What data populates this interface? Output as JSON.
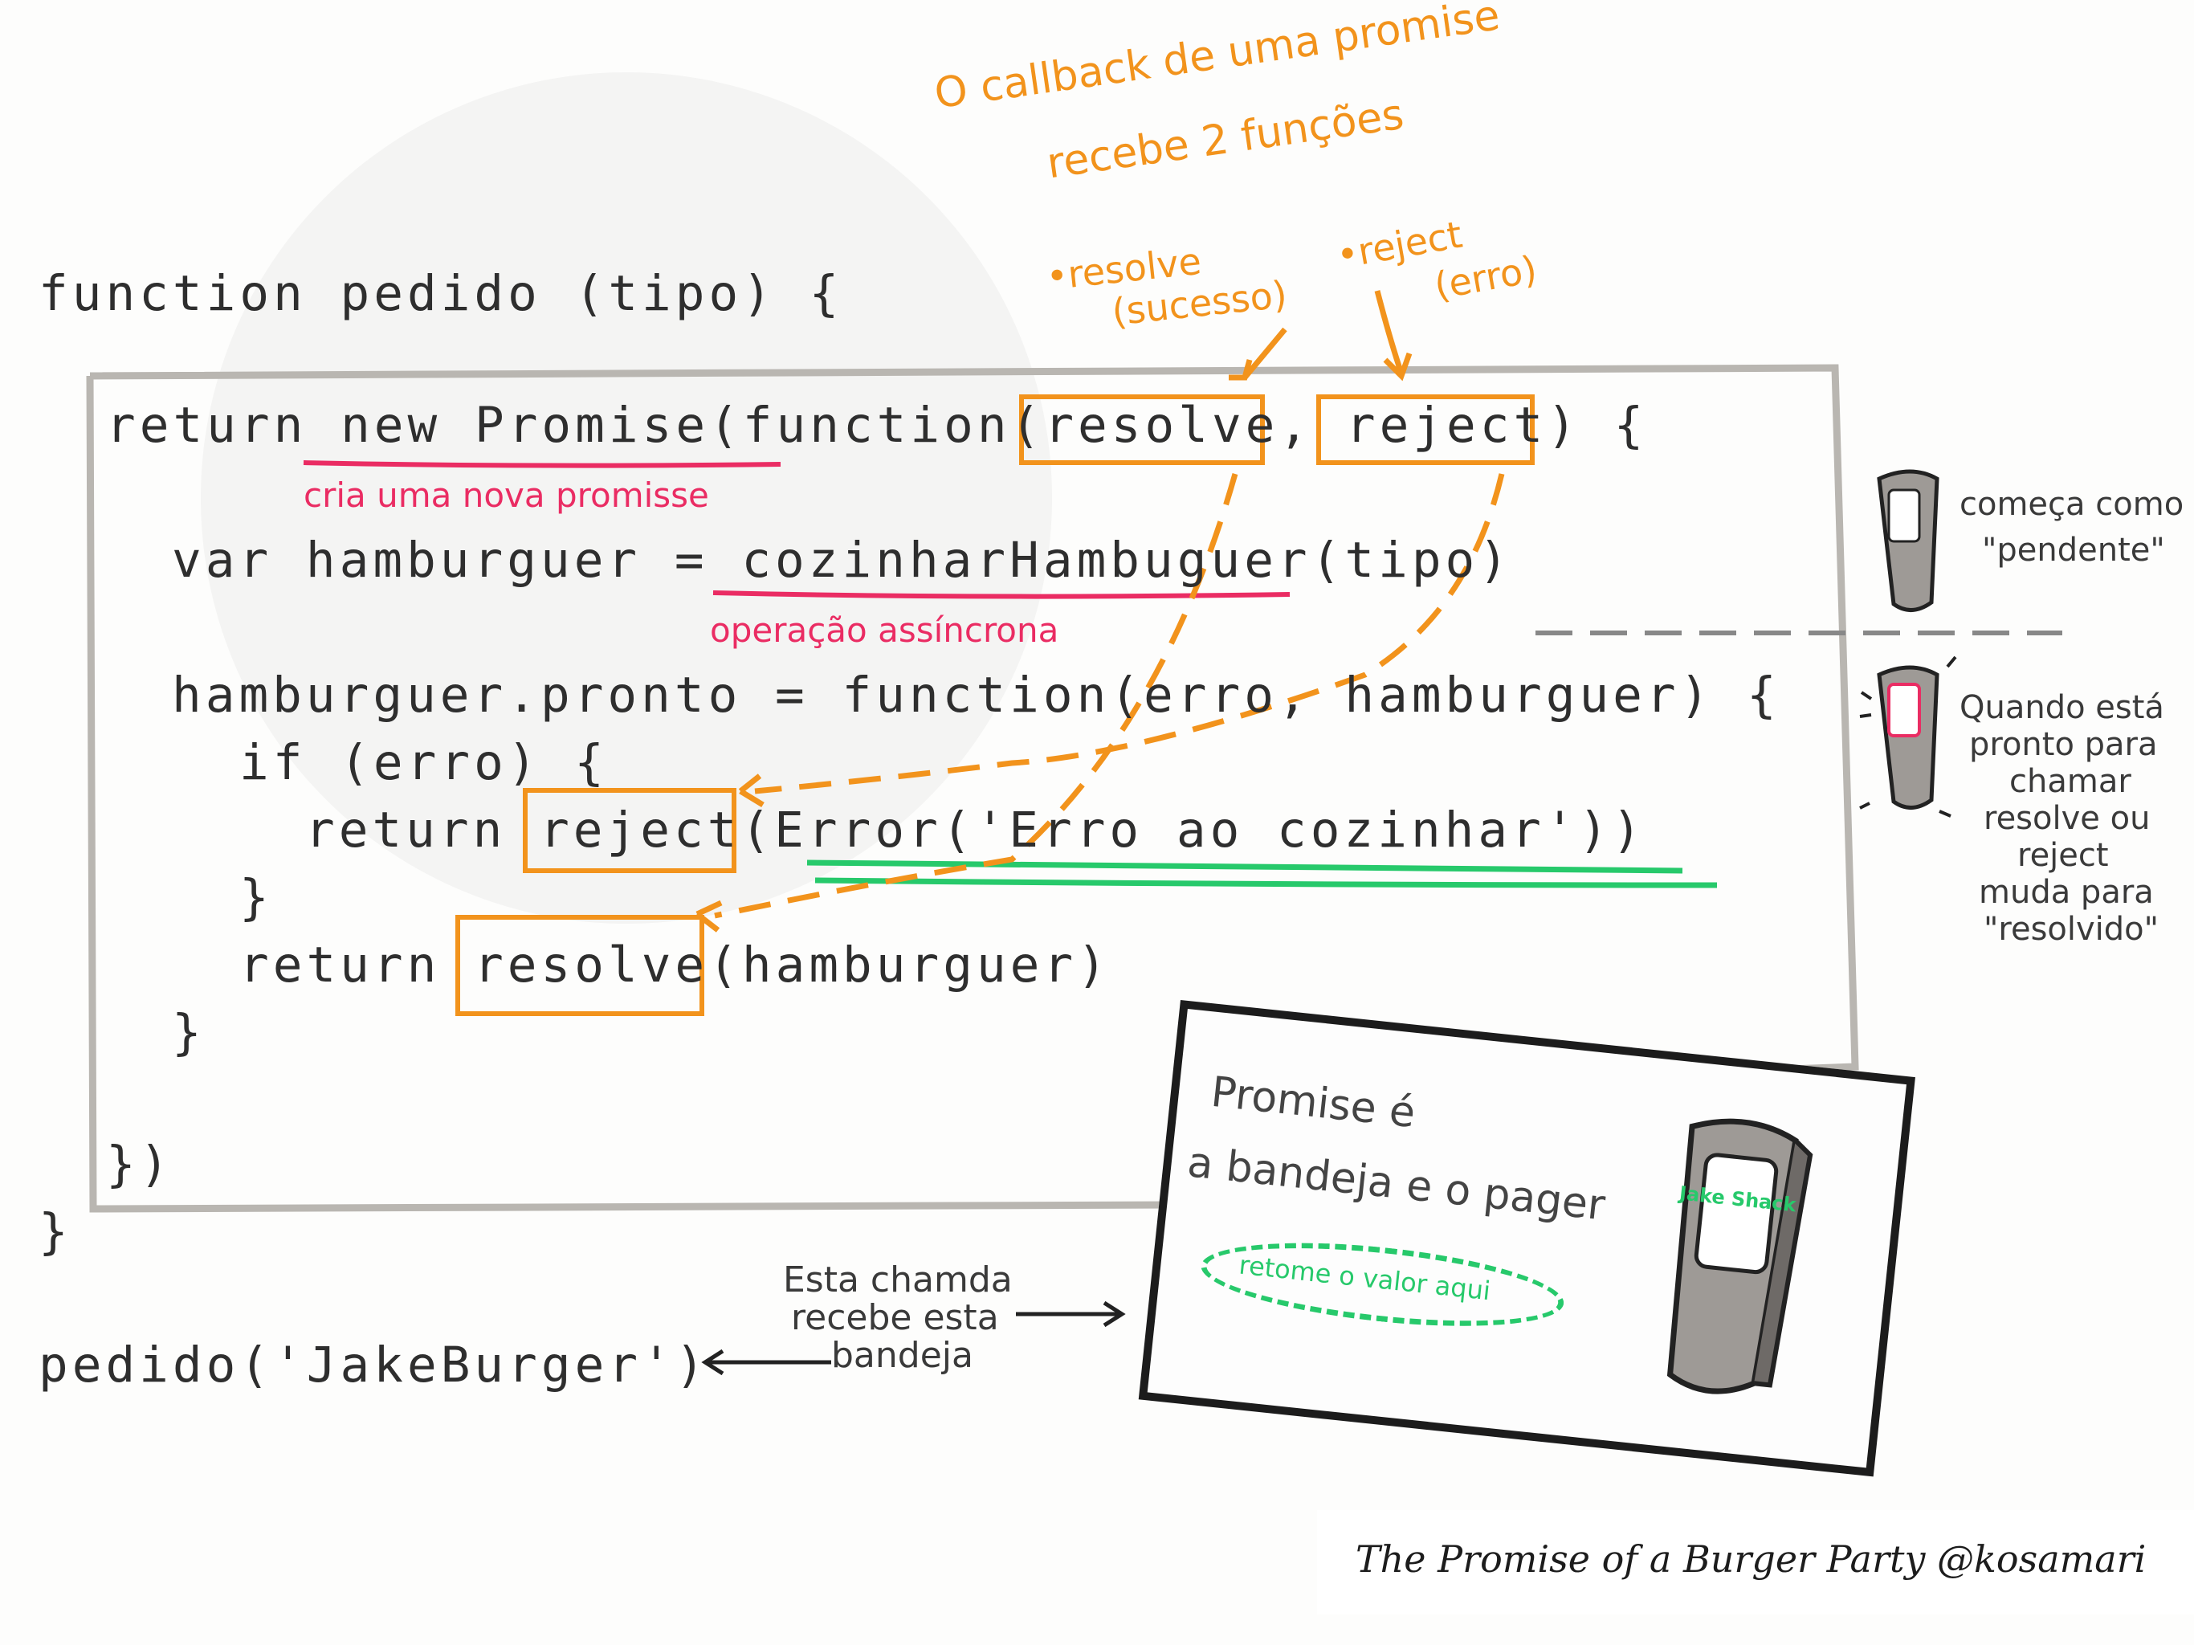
{
  "code": {
    "line1": "function pedido (tipo) {",
    "line2_a": "return ",
    "line2_b": "new Promise(",
    "line2_c": "function(",
    "line2_resolve": "resolve",
    "line2_d": ", ",
    "line2_reject": "reject",
    "line2_e": ") {",
    "line3_a": "var hamburguer = ",
    "line3_b": "cozinharHambuguer",
    "line3_c": "(tipo)",
    "line4": "hamburguer.pronto = function(erro, hamburguer) {",
    "line5": "if (erro) {",
    "line6_a": "return ",
    "line6_reject": "reject",
    "line6_b": "(Error('Erro ao cozinhar'))",
    "line7": "}",
    "line8_a": "return ",
    "line8_resolve": "resolve",
    "line8_b": "(hamburguer)",
    "line9": "}",
    "line10": "})",
    "line11": "}",
    "call": "pedido('JakeBurger')"
  },
  "notes": {
    "top_title_1": "O callback de uma promise",
    "top_title_2": "recebe 2 funções",
    "resolve_label_1": "•resolve",
    "resolve_label_2": "(sucesso)",
    "reject_label_1": "•reject",
    "reject_label_2": "(erro)",
    "new_promise": "cria uma nova promisse",
    "async_op": "operação assíncrona",
    "pending_1": "começa como",
    "pending_2": "\"pendente\"",
    "ready_1": "Quando está",
    "ready_2": "pronto para",
    "ready_3": "chamar",
    "ready_4": "resolve ou",
    "ready_5": "reject",
    "ready_6": "muda para",
    "ready_7": "\"resolvido\"",
    "call_note_1": "Esta chamda",
    "call_note_2": "recebe esta",
    "call_note_3": "bandeja"
  },
  "card": {
    "line1": "Promise é",
    "line2": "a bandeja e o pager",
    "pill": "retome o valor aqui",
    "pager_text": "Jake Shack"
  },
  "credit": "The Promise of a Burger Party @kosamari",
  "colors": {
    "orange": "#f2931c",
    "pink": "#ea2c63",
    "green": "#27c96b",
    "ink": "#2e2e2e",
    "frame": "#b9b6b1"
  }
}
